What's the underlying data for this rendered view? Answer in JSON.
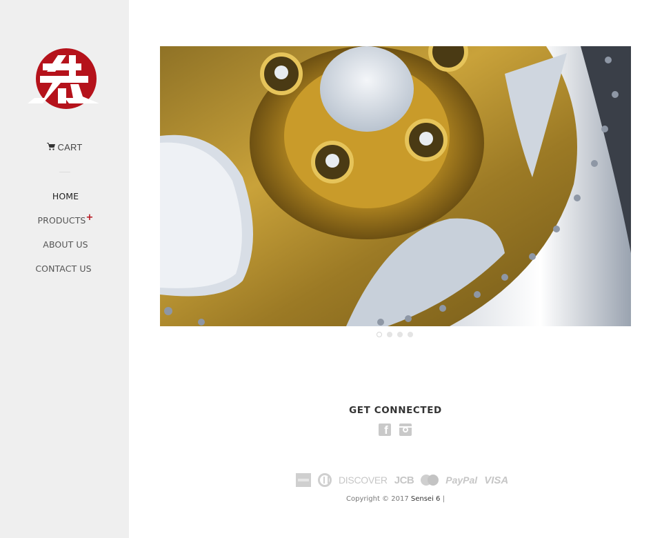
{
  "sidebar": {
    "logo_alt": "Sensei 6 logo",
    "cart": {
      "icon": "cart-icon",
      "label": "CART"
    },
    "nav": [
      {
        "label": "HOME",
        "active": true
      },
      {
        "label": "PRODUCTS",
        "has_submenu": true,
        "submenu_indicator": "+"
      },
      {
        "label": "ABOUT US"
      },
      {
        "label": "CONTACT US"
      }
    ]
  },
  "slideshow": {
    "image_alt": "Gold chrome five-spoke wheel close-up",
    "slide_count": 4,
    "active_slide": 1
  },
  "footer": {
    "social_heading": "GET CONNECTED",
    "social": [
      {
        "name": "Facebook",
        "icon": "facebook-icon"
      },
      {
        "name": "Instagram",
        "icon": "instagram-icon"
      }
    ],
    "payments": [
      {
        "name": "American Express",
        "icon": "amex-icon"
      },
      {
        "name": "Diners Club",
        "icon": "diners-icon"
      },
      {
        "name": "Discover",
        "label": "DISCOVER"
      },
      {
        "name": "JCB",
        "label": "JCB"
      },
      {
        "name": "Master",
        "icon": "mastercard-icon"
      },
      {
        "name": "PayPal",
        "label": "PayPal"
      },
      {
        "name": "Visa",
        "label": "VISA"
      }
    ],
    "copyright_prefix": "Copyright © 2017",
    "brand": "Sensei 6",
    "separator": "|"
  },
  "colors": {
    "accent": "#b5121b",
    "sidebar_bg": "#efefef"
  }
}
